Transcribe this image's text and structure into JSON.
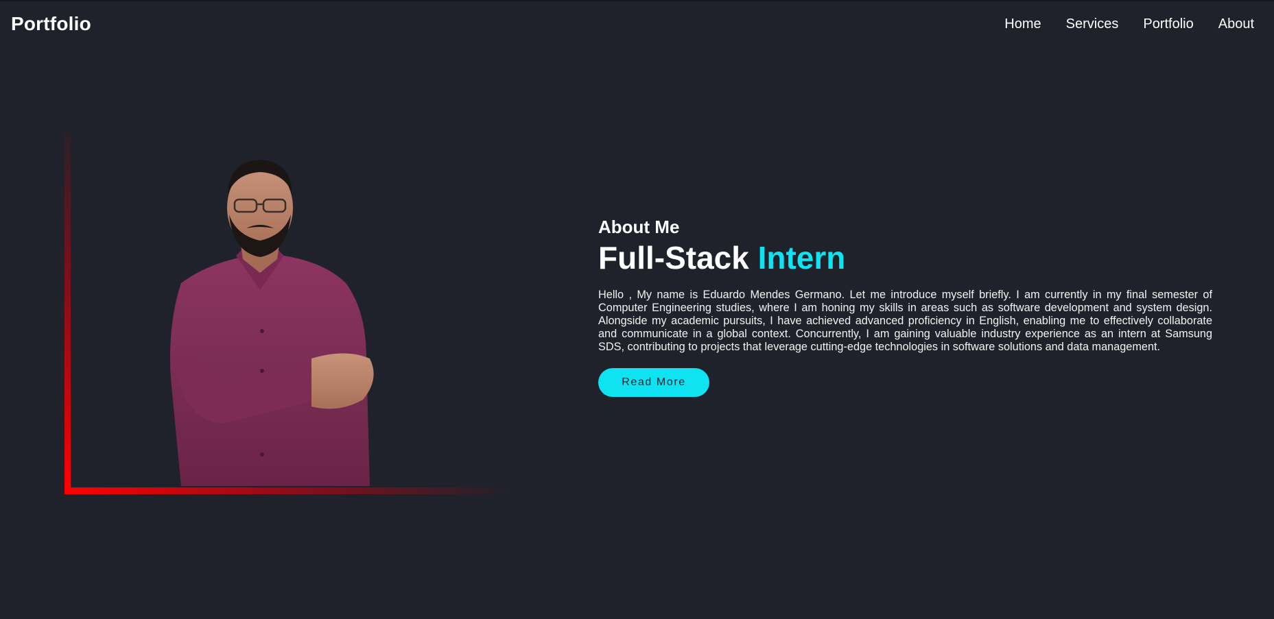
{
  "header": {
    "logo": "Portfolio",
    "nav": [
      {
        "label": "Home"
      },
      {
        "label": "Services"
      },
      {
        "label": "Portfolio"
      },
      {
        "label": "About"
      }
    ]
  },
  "about": {
    "eyebrow": "About Me",
    "headline_main": "Full-Stack",
    "headline_accent": "Intern",
    "bio": "Hello , My name is Eduardo Mendes Germano. Let me introduce myself briefly. I am currently in my final semester of Computer Engineering studies, where I am honing my skills in areas such as software development and system design. Alongside my academic pursuits, I have achieved advanced proficiency in English, enabling me to effectively collaborate and communicate in a global context. Concurrently, I am gaining valuable industry experience as an intern at Samsung SDS, contributing to projects that leverage cutting-edge technologies in software solutions and data management.",
    "cta_label": "Read More"
  },
  "colors": {
    "background": "#1f222a",
    "accent": "#0fe3f2",
    "frame": "#ff0000",
    "text": "#ffffff"
  }
}
